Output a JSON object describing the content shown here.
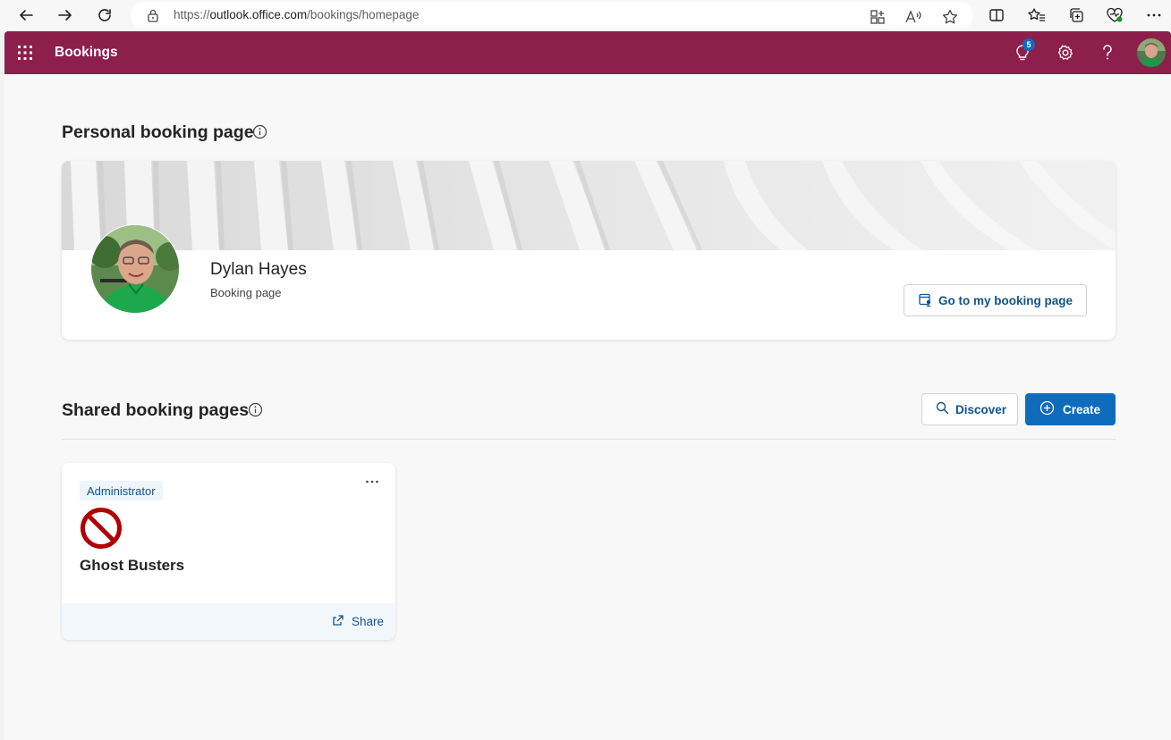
{
  "browser": {
    "url_prefix": "https://",
    "url_host": "outlook.office.com",
    "url_path": "/bookings/homepage"
  },
  "header": {
    "app_title": "Bookings",
    "notification_count": "5",
    "brand_color": "#8c1f4c"
  },
  "personal": {
    "section_title": "Personal booking page",
    "name": "Dylan Hayes",
    "subtitle": "Booking page",
    "goto_label": "Go to my booking page"
  },
  "shared": {
    "section_title": "Shared booking pages",
    "discover_label": "Discover",
    "create_label": "Create",
    "cards": [
      {
        "role": "Administrator",
        "title": "Ghost Busters",
        "share_label": "Share"
      }
    ]
  },
  "colors": {
    "accent": "#0f6cbd",
    "link": "#0f548c"
  }
}
